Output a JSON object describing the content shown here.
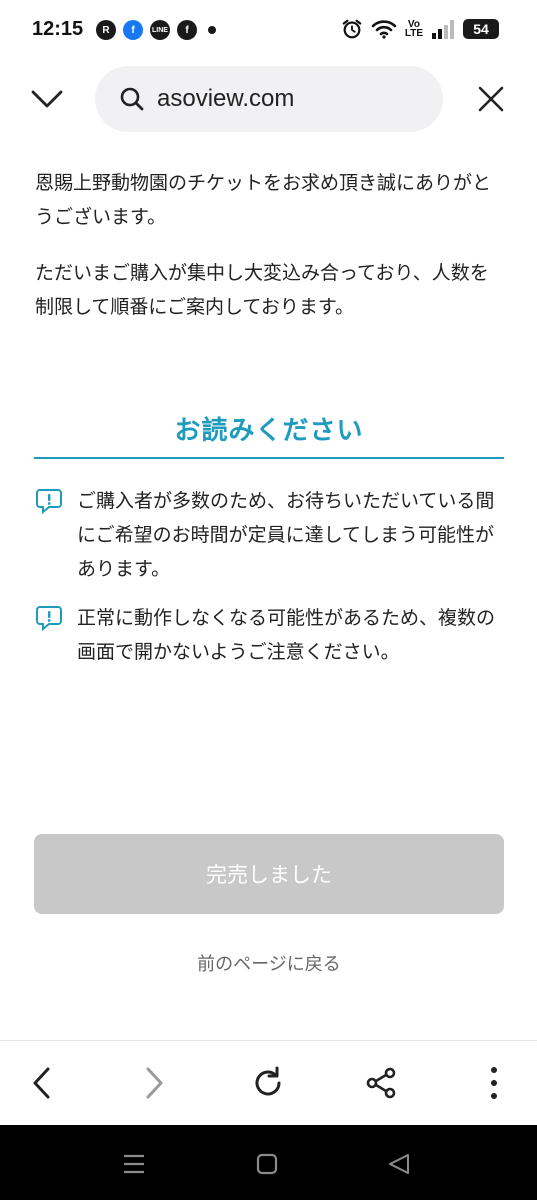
{
  "status_bar": {
    "time": "12:15",
    "notification_icons": [
      "rakuten-link-icon",
      "facebook-icon",
      "line-icon",
      "facebook-icon"
    ],
    "volte_top": "Vo",
    "volte_bottom": "LTE",
    "battery_level": "54"
  },
  "browser": {
    "url": "asoview.com"
  },
  "content": {
    "intro_1": "恩賜上野動物園のチケットをお求め頂き誠にありがとうございます。",
    "intro_2": "ただいまご購入が集中し大変込み合っており、人数を制限して順番にご案内しております。",
    "notice_title": "お読みください",
    "notice_items": [
      "ご購入者が多数のため、お待ちいただいている間にご希望のお時間が定員に達してしまう可能性があります。",
      "正常に動作しなくなる可能性があるため、複数の画面で開かないようご注意ください。"
    ],
    "sold_out_button": "完売しました",
    "back_link": "前のページに戻る"
  },
  "colors": {
    "accent": "#1e9bbd",
    "disabled_button": "#c8c8c8",
    "url_pill": "#f1f1f3"
  }
}
